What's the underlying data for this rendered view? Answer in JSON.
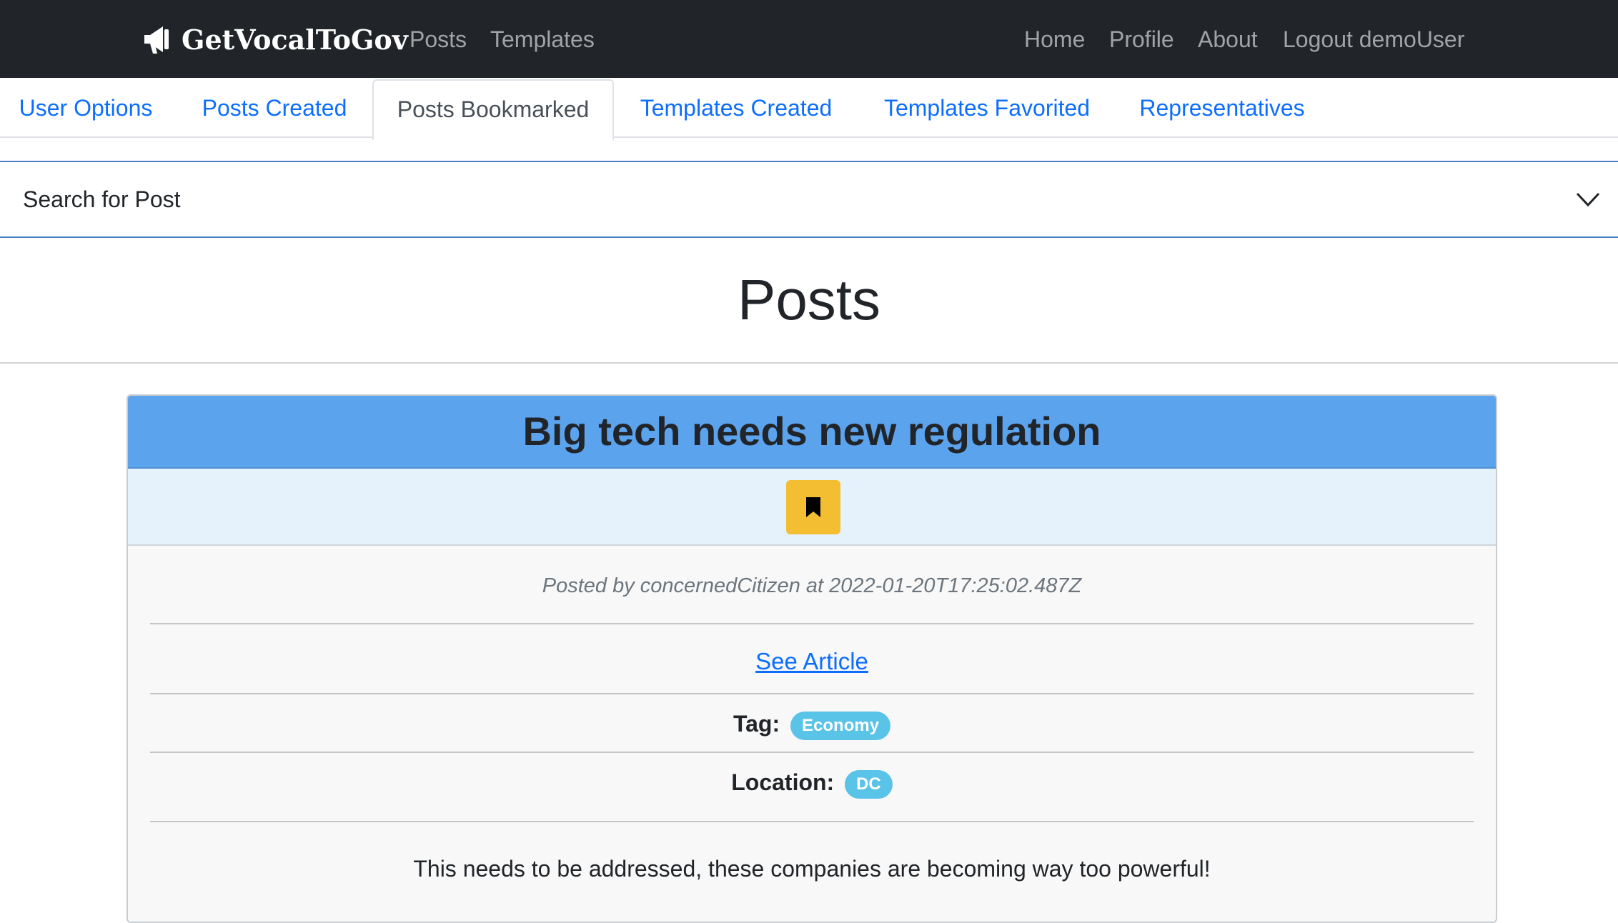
{
  "navbar": {
    "brand": "GetVocalToGov",
    "left_links": [
      "Posts",
      "Templates"
    ],
    "right_links": [
      "Home",
      "Profile",
      "About",
      "Logout demoUser"
    ]
  },
  "tabs": [
    {
      "label": "User Options",
      "active": false
    },
    {
      "label": "Posts Created",
      "active": false
    },
    {
      "label": "Posts Bookmarked",
      "active": true
    },
    {
      "label": "Templates Created",
      "active": false
    },
    {
      "label": "Templates Favorited",
      "active": false
    },
    {
      "label": "Representatives",
      "active": false
    }
  ],
  "search": {
    "label": "Search for Post"
  },
  "page": {
    "title": "Posts"
  },
  "post": {
    "title": "Big tech needs new regulation",
    "bookmarked": true,
    "meta": "Posted by concernedCitizen at 2022-01-20T17:25:02.487Z",
    "article_link": "See Article",
    "tag_label": "Tag:",
    "tag": "Economy",
    "location_label": "Location:",
    "location": "DC",
    "body": "This needs to be addressed, these companies are becoming way too powerful!"
  },
  "colors": {
    "navbar_bg": "#212529",
    "link": "#0d6efd",
    "card_header": "#5ca3ee",
    "card_actions": "#e5f1fb",
    "bookmark_button": "#f4be33",
    "pill": "#59c3e8"
  },
  "icons": {
    "brand": "megaphone-icon",
    "bookmark": "bookmark-icon",
    "accordion": "chevron-down-icon"
  }
}
